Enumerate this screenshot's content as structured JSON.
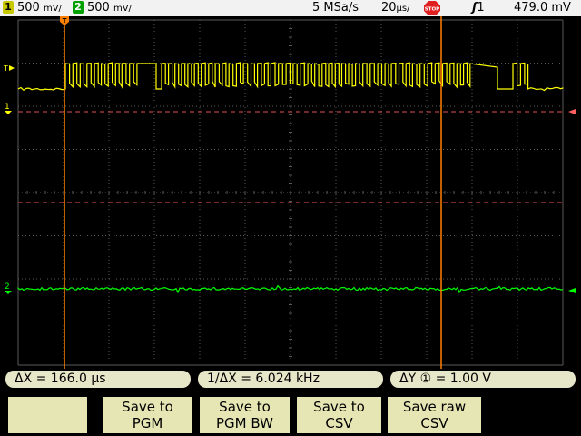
{
  "status_bar": {
    "ch1_number": "1",
    "ch1_scale": "500",
    "ch1_unit": "mV/",
    "ch2_number": "2",
    "ch2_scale": "500",
    "ch2_unit": "mV/",
    "sample_rate": "5 MSa/s",
    "timebase": "20",
    "timebase_unit": "µs/",
    "run_state": "STOP",
    "trigger_source": "1",
    "trigger_level": "479.0 mV"
  },
  "markers": {
    "trigger_marker": "T",
    "ch1_label": "1",
    "ch2_label": "2"
  },
  "measurements": {
    "delta_x": "ΔX = 166.0 µs",
    "inv_delta_x": "1/ΔX =  6.024 kHz",
    "delta_y": "ΔY ① =  1.00  V"
  },
  "softkeys": [
    {
      "line1": "",
      "line2": ""
    },
    {
      "line1": "Save to",
      "line2": "PGM"
    },
    {
      "line1": "Save to",
      "line2": "PGM BW"
    },
    {
      "line1": "Save to",
      "line2": "CSV"
    },
    {
      "line1": "Save raw",
      "line2": "CSV"
    }
  ],
  "colors": {
    "ch1": "#ffff00",
    "ch2": "#00ff00",
    "cursor": "#ff8000",
    "grid": "#5a5a5a",
    "softkey": "#e6e6b4"
  }
}
